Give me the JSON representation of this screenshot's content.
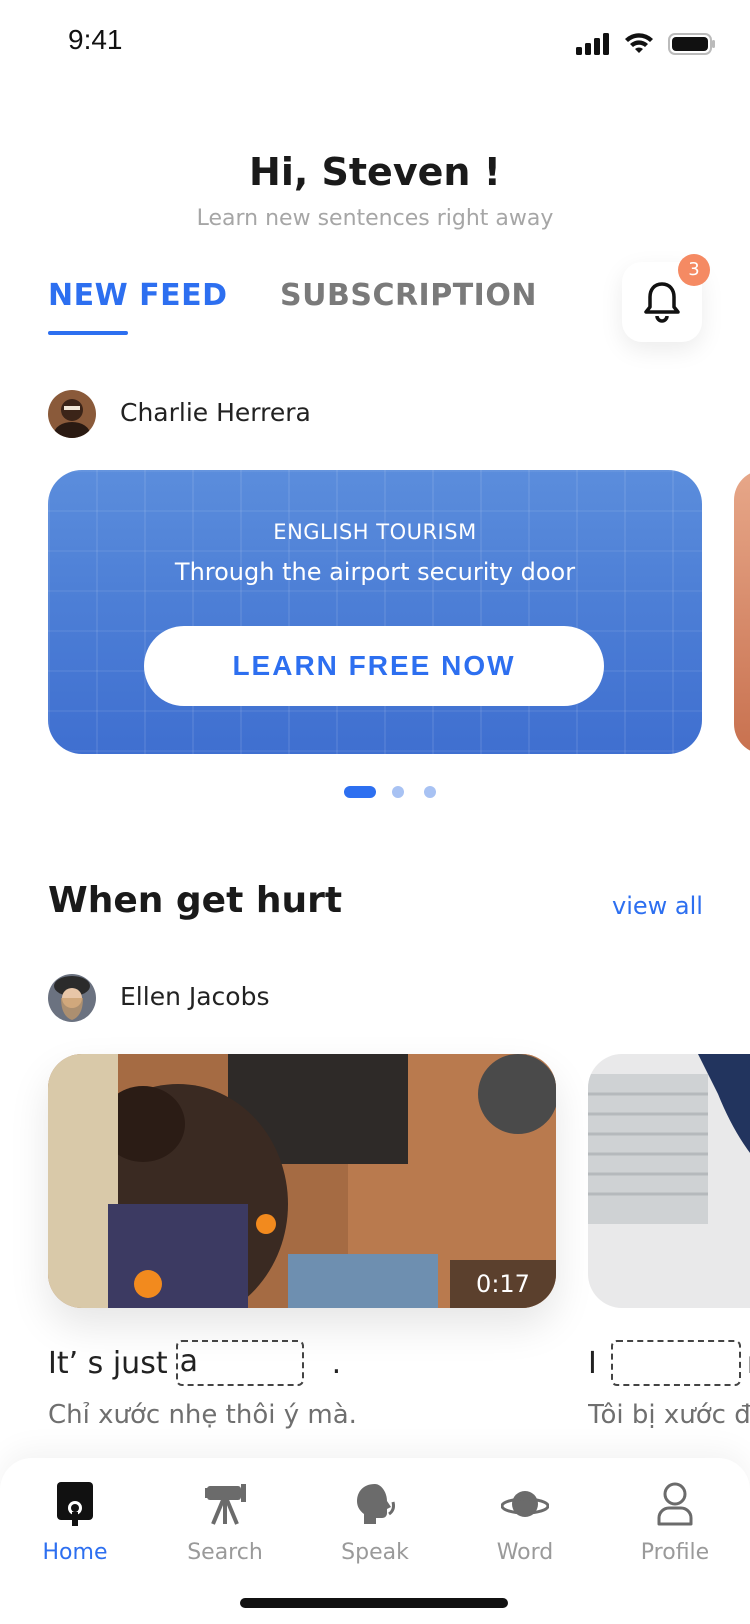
{
  "status_bar": {
    "time": "9:41"
  },
  "header": {
    "greeting": "Hi, Steven !",
    "subtitle": "Learn new sentences right away"
  },
  "tabs": [
    {
      "label": "NEW FEED",
      "active": true
    },
    {
      "label": "SUBSCRIPTION",
      "active": false
    }
  ],
  "notifications": {
    "count": "3",
    "icon": "bell-icon"
  },
  "feed": {
    "author": "Charlie Herrera",
    "card": {
      "category": "ENGLISH TOURISM",
      "title": "Through the airport security door",
      "button_label": "LEARN FREE NOW"
    },
    "pager": {
      "total": 3,
      "active_index": 0
    }
  },
  "section": {
    "title": "When get hurt",
    "view_all_label": "view all",
    "author": "Ellen Jacobs",
    "videos": [
      {
        "duration": "0:17",
        "sentence_before": "It’ s just",
        "sentence_after": ".",
        "blank_prefix": "a",
        "translation": "Chỉ xước nhẹ thôi ý mà."
      },
      {
        "sentence_before": "I",
        "sentence_after": "r",
        "translation": "Tôi bị xước đ"
      }
    ]
  },
  "bottom_nav": {
    "items": [
      {
        "label": "Home",
        "icon": "home-icon",
        "active": true
      },
      {
        "label": "Search",
        "icon": "telescope-icon",
        "active": false
      },
      {
        "label": "Speak",
        "icon": "speak-icon",
        "active": false
      },
      {
        "label": "Word",
        "icon": "planet-icon",
        "active": false
      },
      {
        "label": "Profile",
        "icon": "profile-icon",
        "active": false
      }
    ]
  },
  "colors": {
    "accent": "#2d6ff0",
    "badge": "#f58a63",
    "muted": "#9a9a9a"
  }
}
